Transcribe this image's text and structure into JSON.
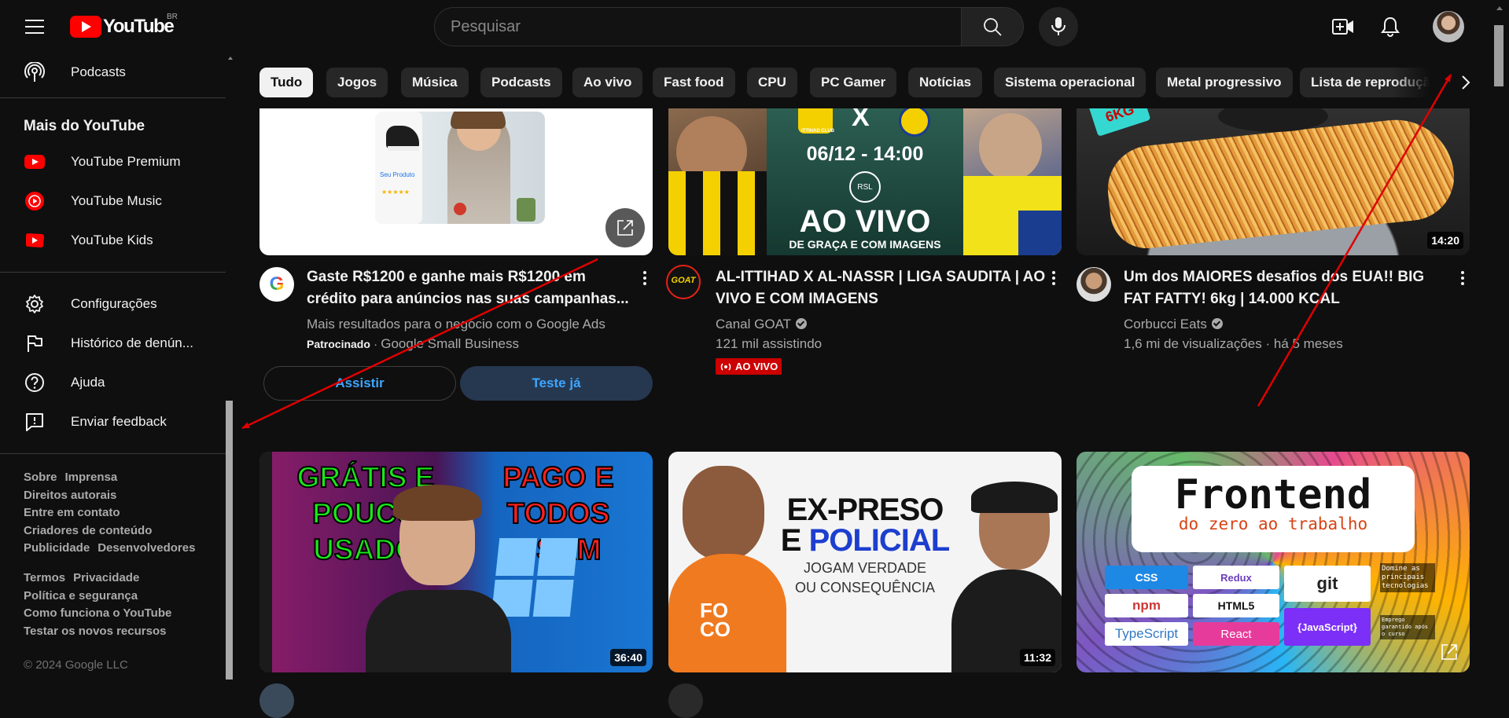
{
  "header": {
    "logo_text": "YouTube",
    "country_code": "BR",
    "search_placeholder": "Pesquisar"
  },
  "sidebar": {
    "top_item": "Podcasts",
    "section_title": "Mais do YouTube",
    "more_items": [
      "YouTube Premium",
      "YouTube Music",
      "YouTube Kids"
    ],
    "settings_items": [
      "Configurações",
      "Histórico de denún...",
      "Ajuda",
      "Enviar feedback"
    ],
    "footer_links_1": [
      "Sobre",
      "Imprensa",
      "Direitos autorais",
      "Entre em contato",
      "Criadores de conteúdo",
      "Publicidade",
      "Desenvolvedores"
    ],
    "footer_links_2": [
      "Termos",
      "Privacidade",
      "Política e segurança",
      "Como funciona o YouTube",
      "Testar os novos recursos"
    ],
    "copyright": "© 2024 Google LLC"
  },
  "chips": [
    "Tudo",
    "Jogos",
    "Música",
    "Podcasts",
    "Ao vivo",
    "Fast food",
    "CPU",
    "PC Gamer",
    "Notícias",
    "Sistema operacional",
    "Metal progressivo",
    "Lista de reprodução"
  ],
  "videos": [
    {
      "title": "Gaste R$1200 e ganhe mais R$1200 em crédito para anúncios nas suas campanhas...",
      "meta1": "Mais resultados para o negócio com o Google Ads",
      "sponsored": "Patrocinado",
      "channel": "Google Small Business",
      "btn_watch": "Assistir",
      "btn_try": "Teste já",
      "thumb_card": "Seu Produto"
    },
    {
      "title": "AL-ITTIHAD X AL-NASSR | LIGA SAUDITA | AO VIVO E COM IMAGENS",
      "channel": "Canal GOAT",
      "views": "121 mil assistindo",
      "live": "AO VIVO",
      "thumb_date": "06/12 - 14:00",
      "thumb_big": "AO VIVO",
      "thumb_sub": "DE GRAÇA E COM IMAGENS",
      "thumb_x": "X",
      "thumb_club": "ITTIHAD CLUB",
      "thumb_rsl": "RSL",
      "avatar_text": "GOAT"
    },
    {
      "title": "Um dos MAIORES desafios dos EUA!! BIG FAT FATTY! 6kg | 14.000 KCAL",
      "channel": "Corbucci Eats",
      "views": "1,6 mi de visualizações",
      "age": "há 5 meses",
      "duration": "14:20",
      "thumb_tag": "6KG"
    },
    {
      "duration": "36:40",
      "thumb_left": [
        "GRÁTIS E",
        "POUCO",
        "USADO"
      ],
      "thumb_right": [
        "PAGO E TODOS",
        "USAM"
      ]
    },
    {
      "duration": "11:32",
      "thumb_l1": "EX-PRESO",
      "thumb_l2a": "E ",
      "thumb_l2b": "POLICIAL",
      "thumb_l3": "JOGAM VERDADE",
      "thumb_l4": "OU CONSEQUÊNCIA",
      "shirt_text": "FO CO"
    },
    {
      "thumb_title": "Frontend",
      "thumb_sub": "do zero ao trabalho",
      "tags": [
        "CSS",
        "Redux",
        "git",
        "npm",
        "HTML5",
        "TypeScript",
        "React",
        "{JavaScript}"
      ],
      "side_note": "Domine as principais tecnologias",
      "side_note2": "Emprego garantido após o curso"
    }
  ],
  "colors": {
    "accent_red": "#ff0000",
    "link_blue": "#3ea6ff",
    "live_red": "#cc0000",
    "annotation_red": "#e00000"
  }
}
